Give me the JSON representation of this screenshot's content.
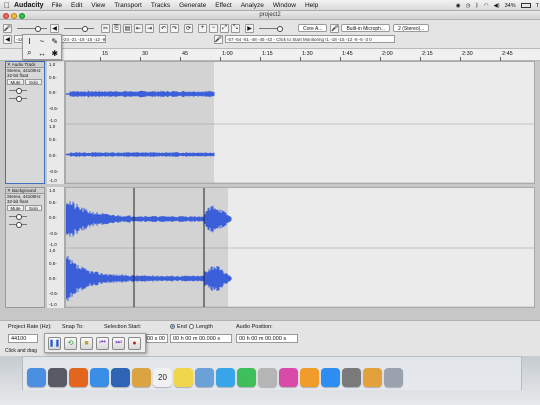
{
  "menubar": {
    "apple": "",
    "app": "Audacity",
    "items": [
      "File",
      "Edit",
      "View",
      "Transport",
      "Tracks",
      "Generate",
      "Effect",
      "Analyze",
      "Window",
      "Help"
    ],
    "battery": "34%"
  },
  "window": {
    "title": "project2",
    "close_color": "#ff5f57",
    "min_color": "#febc2e",
    "max_color": "#28c840"
  },
  "toolbar": {
    "meter_text": "-57 -54 -51 -48 -45 -42 - Click to Start Monitoring !1 -18 -15 -12 -9 -6 -3 0",
    "meter_text_top": "-42 -39 -36 -33 -30 -27 -24 -21 -18 -15 -12 -9 -6 -3 0",
    "host": "Core A...",
    "input_device": "Built-in Microph...",
    "channels": "2 (Stereo)..."
  },
  "tools": {
    "selection": "I",
    "envelope": "~",
    "draw": "✎",
    "zoom": "⌕",
    "timeshift": "↔",
    "multi": "✱"
  },
  "ruler": {
    "ticks": [
      {
        "label": "15"
      },
      {
        "label": "30"
      },
      {
        "label": "45"
      },
      {
        "label": "1:00"
      },
      {
        "label": "1:15"
      },
      {
        "label": "1:30"
      },
      {
        "label": "1:45"
      },
      {
        "label": "2:00"
      },
      {
        "label": "2:15"
      },
      {
        "label": "2:30"
      },
      {
        "label": "2:45"
      }
    ]
  },
  "tracks": [
    {
      "name": "Audio Track",
      "rate": "Stereo, 44100Hz",
      "format": "32-bit float",
      "mute": "Mute",
      "solo": "Solo",
      "scale": [
        "1.0",
        "0.5-",
        "0.0-",
        "-0.5-",
        "-1.0"
      ]
    },
    {
      "name": "Background",
      "rate": "Stereo, 44100Hz",
      "format": "32-bit float",
      "mute": "Mute",
      "solo": "Solo",
      "scale": [
        "1.0",
        "0.5-",
        "0.0-",
        "-0.5-",
        "-1.0"
      ]
    }
  ],
  "waveform_color": "#3a5fd9",
  "bottom": {
    "project_rate_label": "Project Rate (Hz):",
    "snap_to_label": "Snap To:",
    "selection_start_label": "Selection Start:",
    "end_label": "End",
    "length_label": "Length",
    "audio_position_label": "Audio Position:",
    "rate_value": "44100",
    "time_start": "00 h 00 m 00.000 s",
    "time_end": "00 h 00 m 00.000 s",
    "time_pos": "00 h 00 m 00.000 s",
    "status": "Click and drag"
  },
  "dock": {
    "icons": [
      {
        "name": "finder",
        "color": "#4a8fe0"
      },
      {
        "name": "launchpad",
        "color": "#5a5a66"
      },
      {
        "name": "firefox",
        "color": "#e2661d"
      },
      {
        "name": "safari",
        "color": "#3a8ee6"
      },
      {
        "name": "photo",
        "color": "#2f63b4"
      },
      {
        "name": "notes",
        "color": "#d9a441"
      },
      {
        "name": "calendar",
        "color": "#f1f1f1"
      },
      {
        "name": "stickies",
        "color": "#f0d64a"
      },
      {
        "name": "preview",
        "color": "#6aa2d8"
      },
      {
        "name": "messages",
        "color": "#38a4ea"
      },
      {
        "name": "facetime",
        "color": "#3fbf5b"
      },
      {
        "name": "photos",
        "color": "#b5b5b5"
      },
      {
        "name": "itunes",
        "color": "#d94ba8"
      },
      {
        "name": "ibooks",
        "color": "#f09c2a"
      },
      {
        "name": "appstore",
        "color": "#2d8df0"
      },
      {
        "name": "preferences",
        "color": "#7a7a7a"
      },
      {
        "name": "audacity",
        "color": "#e2a13c"
      },
      {
        "name": "trash",
        "color": "#9aa3ad"
      }
    ],
    "calendar_day": "20"
  }
}
